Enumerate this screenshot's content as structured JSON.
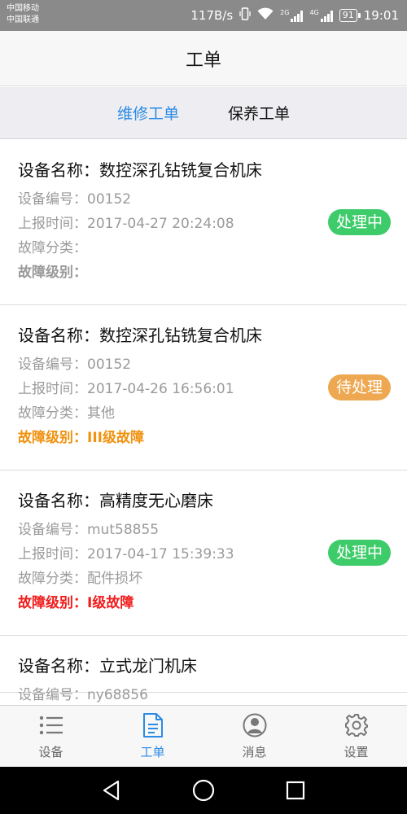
{
  "status_bar": {
    "carrier_1": "中国移动",
    "carrier_2": "中国联通",
    "speed": "117B/s",
    "sig1_label": "2G",
    "sig2_label": "4G",
    "battery": "91",
    "time": "19:01"
  },
  "header": {
    "title": "工单"
  },
  "tabs": [
    {
      "label": "维修工单",
      "active": true
    },
    {
      "label": "保养工单",
      "active": false
    }
  ],
  "orders": [
    {
      "name": "设备名称：数控深孔钻铣复合机床",
      "code": "设备编号：00152",
      "time": "上报时间：2017-04-27 20:24:08",
      "category": "故障分类：",
      "level": "故障级别：",
      "level_color": "#9a9a9a",
      "status": "处理中",
      "status_color": "#3ecb6a"
    },
    {
      "name": "设备名称：数控深孔钻铣复合机床",
      "code": "设备编号：00152",
      "time": "上报时间：2017-04-26 16:56:01",
      "category": "故障分类：其他",
      "level": "故障级别：III级故障",
      "level_color": "#f0920f",
      "status": "待处理",
      "status_color": "#eda851"
    },
    {
      "name": "设备名称：高精度无心磨床",
      "code": "设备编号：mut58855",
      "time": "上报时间：2017-04-17 15:39:33",
      "category": "故障分类：配件损坏",
      "level": "故障级别：I级故障",
      "level_color": "#f21c1c",
      "status": "处理中",
      "status_color": "#3ecb6a"
    },
    {
      "name": "设备名称：立式龙门机床",
      "code": "设备编号：ny68856"
    }
  ],
  "bottom_nav": [
    {
      "label": "设备",
      "icon": "list-icon",
      "active": false
    },
    {
      "label": "工单",
      "icon": "document-icon",
      "active": true
    },
    {
      "label": "消息",
      "icon": "user-icon",
      "active": false
    },
    {
      "label": "设置",
      "icon": "gear-icon",
      "active": false
    }
  ],
  "colors": {
    "accent": "#2b8be4",
    "processing": "#3ecb6a",
    "pending": "#eda851",
    "level_iii": "#f0920f",
    "level_i": "#f21c1c"
  }
}
